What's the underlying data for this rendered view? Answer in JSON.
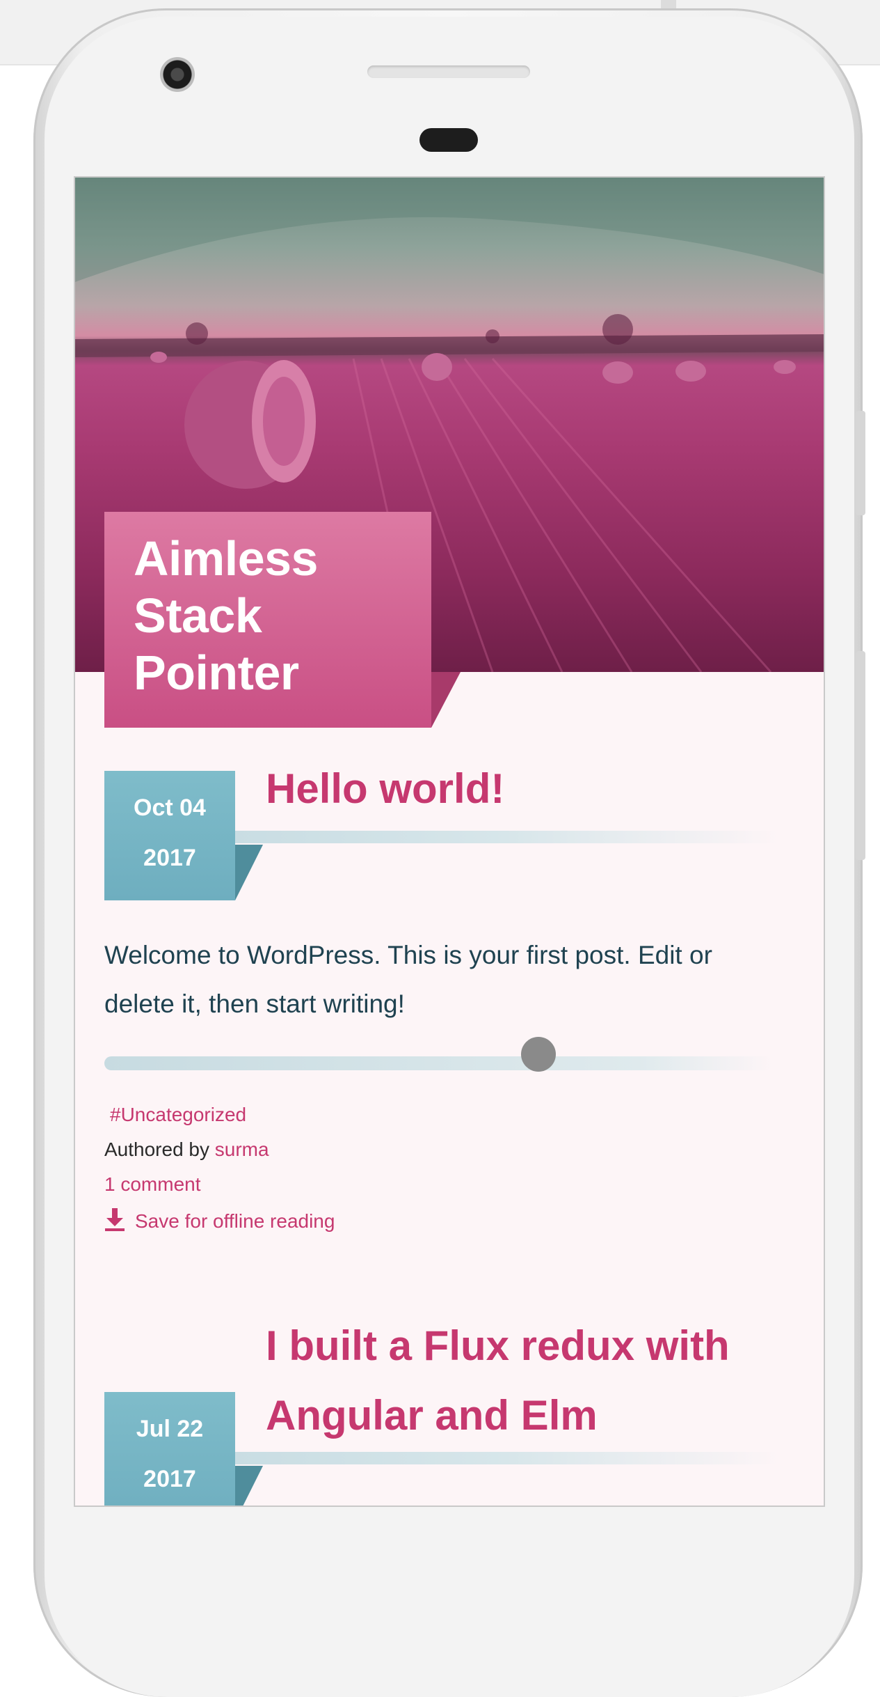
{
  "colors": {
    "accent_pink": "#c6386f",
    "title_box": "#d25f8d",
    "date_box": "#77b6c6",
    "body_text": "#1f4250",
    "screen_bg": "#fdf5f7"
  },
  "site": {
    "title_lines": [
      "Aimless",
      "Stack",
      "Pointer"
    ]
  },
  "posts": [
    {
      "date_line1": "Oct 04",
      "date_line2": "2017",
      "title": "Hello world!",
      "excerpt": "Welcome to WordPress. This is your first post. Edit or delete it, then start writing!",
      "reading_progress": 0.65,
      "category": "#Uncategorized",
      "authored_by_label": "Authored by",
      "author": "surma",
      "comments": "1 comment",
      "save_offline": "Save for offline reading"
    },
    {
      "date_line1": "Jul 22",
      "date_line2": "2017",
      "title_lines": [
        "I built a Flux redux with",
        "Angular and Elm"
      ]
    }
  ],
  "icons": {
    "download": "download-icon"
  }
}
